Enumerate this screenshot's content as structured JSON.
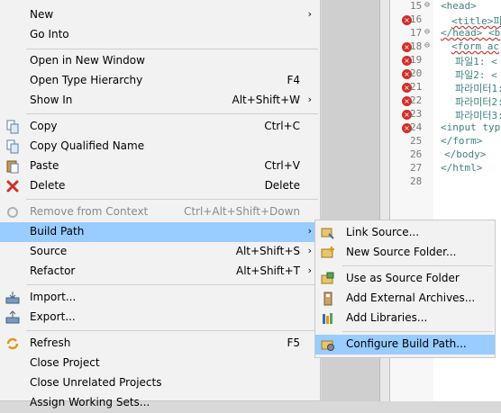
{
  "context_menu": {
    "items": [
      {
        "label": "New",
        "accel": "",
        "submenu": true
      },
      {
        "label": "Go Into",
        "accel": ""
      },
      {
        "label": "Open in New Window",
        "accel": ""
      },
      {
        "label": "Open Type Hierarchy",
        "accel": "F4"
      },
      {
        "label": "Show In",
        "accel": "Alt+Shift+W",
        "submenu": true
      },
      {
        "label": "Copy",
        "accel": "Ctrl+C",
        "icon": "copy-icon"
      },
      {
        "label": "Copy Qualified Name",
        "accel": "",
        "icon": "copy-qualified-name-icon"
      },
      {
        "label": "Paste",
        "accel": "Ctrl+V",
        "icon": "paste-icon"
      },
      {
        "label": "Delete",
        "accel": "Delete",
        "icon": "delete-icon"
      },
      {
        "label": "Remove from Context",
        "accel": "Ctrl+Alt+Shift+Down",
        "disabled": true,
        "icon": "remove-from-context-icon"
      },
      {
        "label": "Build Path",
        "accel": "",
        "submenu": true,
        "selected": true
      },
      {
        "label": "Source",
        "accel": "Alt+Shift+S",
        "submenu": true
      },
      {
        "label": "Refactor",
        "accel": "Alt+Shift+T",
        "submenu": true
      },
      {
        "label": "Import...",
        "accel": "",
        "icon": "import-icon"
      },
      {
        "label": "Export...",
        "accel": "",
        "icon": "export-icon"
      },
      {
        "label": "Refresh",
        "accel": "F5",
        "icon": "refresh-icon"
      },
      {
        "label": "Close Project",
        "accel": ""
      },
      {
        "label": "Close Unrelated Projects",
        "accel": ""
      },
      {
        "label": "Assign Working Sets...",
        "accel": ""
      }
    ]
  },
  "build_path_submenu": {
    "items": [
      {
        "label": "Link Source...",
        "icon": "link-source-icon"
      },
      {
        "label": "New Source Folder...",
        "icon": "new-source-folder-icon"
      },
      {
        "label": "Use as Source Folder",
        "icon": "use-as-source-folder-icon"
      },
      {
        "label": "Add External Archives...",
        "icon": "add-external-archives-icon"
      },
      {
        "label": "Add Libraries...",
        "icon": "add-libraries-icon"
      },
      {
        "label": "Configure Build Path...",
        "icon": "configure-build-path-icon",
        "selected": true
      }
    ]
  },
  "editor": {
    "lines": [
      {
        "num": "15",
        "code": "<head>",
        "fold": "⊖",
        "error": false
      },
      {
        "num": "16",
        "code": "<title>피",
        "error": true
      },
      {
        "num": "17",
        "code": "</head> <b",
        "fold": "⊖",
        "error": false
      },
      {
        "num": "18",
        "code": "<form ac",
        "fold": "⊖",
        "error": true
      },
      {
        "num": "19",
        "code": "파일1: <",
        "error": true
      },
      {
        "num": "20",
        "code": "파일2: <",
        "error": true
      },
      {
        "num": "21",
        "code": "파라미터1:",
        "error": true
      },
      {
        "num": "22",
        "code": "파라미터2:",
        "error": true
      },
      {
        "num": "23",
        "code": "파라미터3:",
        "error": true
      },
      {
        "num": "24",
        "code": "<input typ",
        "error": true
      },
      {
        "num": "25",
        "code": "</form>",
        "error": false
      },
      {
        "num": "26",
        "code": "</body>",
        "error": false
      },
      {
        "num": "27",
        "code": "</html>",
        "error": false
      },
      {
        "num": "28",
        "code": "",
        "error": false
      }
    ]
  },
  "colors": {
    "selection": "#99ccff",
    "menu_bg": "#f2f2f2",
    "error": "#d0302a"
  }
}
